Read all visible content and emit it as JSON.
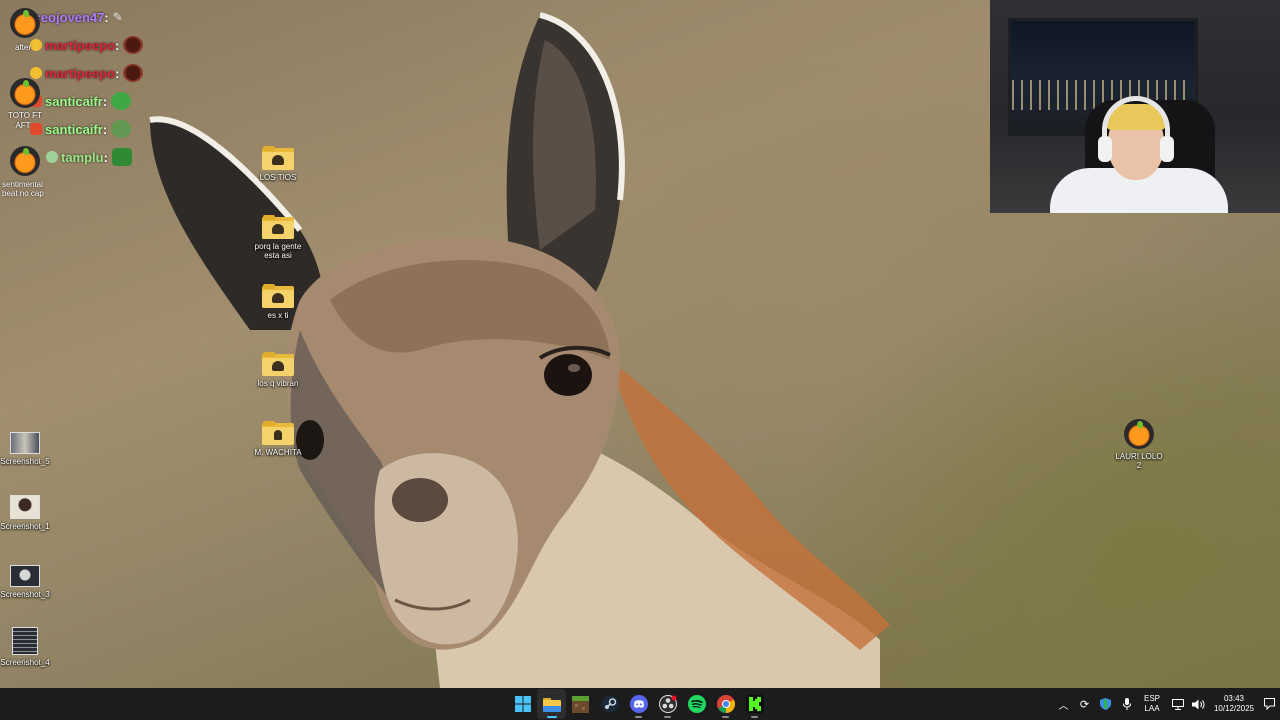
{
  "chat": {
    "messages": [
      {
        "user": "joseojoven47",
        "color": "#b07cff"
      },
      {
        "user": "martipeepo",
        "color": "#e0243b"
      },
      {
        "user": "martipeepo",
        "color": "#e0243b"
      },
      {
        "user": "santicaifr",
        "color": "#9cff8a"
      },
      {
        "user": "santicaifr",
        "color": "#9cff8a"
      },
      {
        "user": "tamplu",
        "color": "#9cff8a"
      }
    ]
  },
  "desktop": {
    "left_notes": {
      "after": "after",
      "toto": "TOTO FT",
      "aft": "AFT",
      "sentimental": "sentimental beat no cap"
    },
    "folders": [
      {
        "label": "LOS TIOS"
      },
      {
        "label": "porq la gente esta asi"
      },
      {
        "label": "es x ti"
      },
      {
        "label": "los q vibran"
      },
      {
        "label": "M. WACHITA"
      }
    ],
    "screenshots": [
      {
        "label": "Screenshot_5"
      },
      {
        "label": "Screenshot_1"
      },
      {
        "label": "Screenshot_3"
      },
      {
        "label": "Screenshot_4"
      }
    ],
    "right_icon": {
      "label": "LAURI LOLO 2"
    }
  },
  "taskbar": {
    "apps": [
      {
        "name": "windows-start-icon"
      },
      {
        "name": "file-explorer-icon"
      },
      {
        "name": "minecraft-icon"
      },
      {
        "name": "steam-icon"
      },
      {
        "name": "discord-icon"
      },
      {
        "name": "obs-icon"
      },
      {
        "name": "spotify-icon"
      },
      {
        "name": "chrome-icon"
      },
      {
        "name": "kick-icon"
      }
    ],
    "tray": {
      "lang_top": "ESP",
      "lang_bottom": "LAA",
      "time": "03:43",
      "date": "10/12/2025"
    }
  },
  "colors": {
    "taskbar_bg": "#1c1c1c",
    "accent": "#4cc2ff",
    "kick_green": "#53fc18",
    "spotify_green": "#1ed760"
  }
}
